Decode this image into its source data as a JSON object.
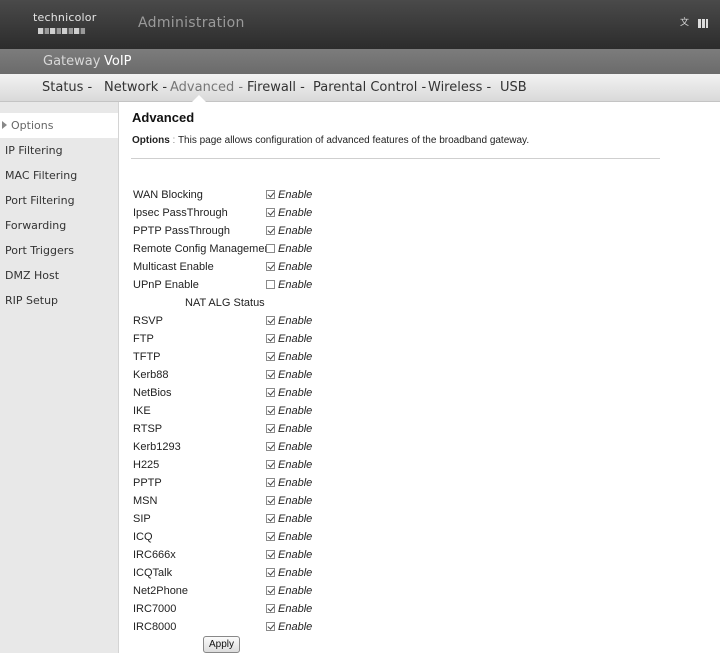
{
  "header": {
    "logo_text": "technicolor",
    "title": "Administration",
    "lang_icon": "language-icon",
    "menu_icon": "menu-icon"
  },
  "nav_top": [
    "Gateway",
    "VoIP"
  ],
  "nav_main": [
    "Status -",
    "Network -",
    "Advanced -",
    "Firewall -",
    "Parental Control -",
    "Wireless -",
    "USB"
  ],
  "sidebar": [
    "Options",
    "IP Filtering",
    "MAC Filtering",
    "Port Filtering",
    "Forwarding",
    "Port Triggers",
    "DMZ Host",
    "RIP Setup"
  ],
  "page": {
    "title": "Advanced",
    "desc_label": "Options",
    "desc_sep": " : ",
    "desc_text": "This page allows configuration of advanced features of the broadband gateway."
  },
  "enable_label": "Enable",
  "settings": [
    {
      "label": "WAN Blocking",
      "checked": true
    },
    {
      "label": "Ipsec PassThrough",
      "checked": true
    },
    {
      "label": "PPTP PassThrough",
      "checked": true
    },
    {
      "label": "Remote Config Management",
      "checked": false
    },
    {
      "label": "Multicast Enable",
      "checked": true
    },
    {
      "label": "UPnP Enable",
      "checked": false
    }
  ],
  "alg_header": "NAT ALG Status",
  "alg": [
    {
      "label": "RSVP",
      "checked": true
    },
    {
      "label": "FTP",
      "checked": true
    },
    {
      "label": "TFTP",
      "checked": true
    },
    {
      "label": "Kerb88",
      "checked": true
    },
    {
      "label": "NetBios",
      "checked": true
    },
    {
      "label": "IKE",
      "checked": true
    },
    {
      "label": "RTSP",
      "checked": true
    },
    {
      "label": "Kerb1293",
      "checked": true
    },
    {
      "label": "H225",
      "checked": true
    },
    {
      "label": "PPTP",
      "checked": true
    },
    {
      "label": "MSN",
      "checked": true
    },
    {
      "label": "SIP",
      "checked": true
    },
    {
      "label": "ICQ",
      "checked": true
    },
    {
      "label": "IRC666x",
      "checked": true
    },
    {
      "label": "ICQTalk",
      "checked": true
    },
    {
      "label": "Net2Phone",
      "checked": true
    },
    {
      "label": "IRC7000",
      "checked": true
    },
    {
      "label": "IRC8000",
      "checked": true
    }
  ],
  "apply_label": "Apply"
}
